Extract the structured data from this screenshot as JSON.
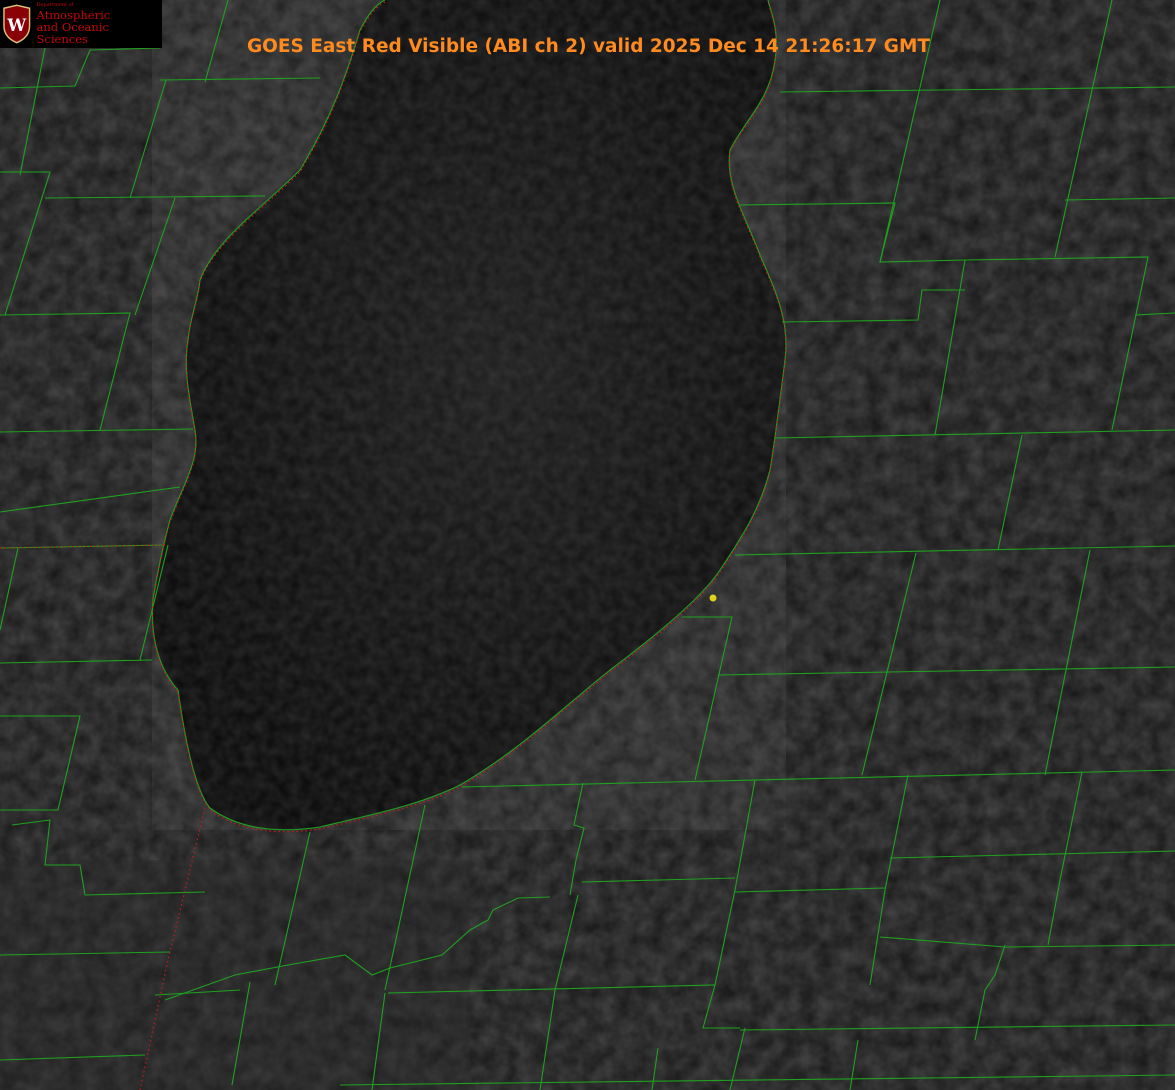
{
  "title": "GOES East Red Visible (ABI ch 2) valid 2025 Dec 14 21:26:17 GMT",
  "logo": {
    "icon": "uw-crest-icon",
    "letter": "W",
    "dept": "Department of",
    "line1": "Atmospheric",
    "line2": "and Oceanic Sciences"
  },
  "colors": {
    "title": "#ff8a1e",
    "county_lines": "#1fa11f",
    "state_line": "#d01818",
    "marker": "#e0d21c",
    "logo_red": "#c5050c",
    "land": "#1a1a1a",
    "lake": "#0a0a0a"
  },
  "map": {
    "feature": "lake",
    "marker_icon": "location-dot-icon"
  }
}
